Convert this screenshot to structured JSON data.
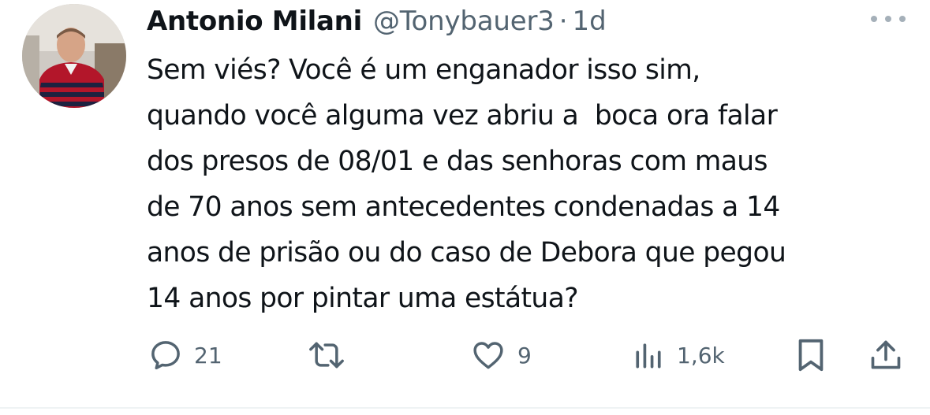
{
  "tweet": {
    "author": {
      "display_name": "Antonio Milani",
      "handle": "@Tonybauer3",
      "separator": "·",
      "time": "1d"
    },
    "text_lines": [
      "Sem viés? Você é um enganador isso sim,",
      "quando você alguma vez abriu a  boca ora falar",
      "dos presos de 08/01 e das senhoras com maus",
      "de 70 anos sem antecedentes condenadas a 14",
      "anos de prisão ou do caso de Debora que pegou",
      "14 anos por pintar uma estátua?"
    ],
    "actions": {
      "replies": "21",
      "retweets": "",
      "likes": "9",
      "views": "1,6k"
    }
  },
  "icons": {
    "more": "more-dots-icon",
    "reply": "reply-bubble-icon",
    "retweet": "retweet-icon",
    "like": "heart-icon",
    "views": "views-bar-chart-icon",
    "bookmark": "bookmark-icon",
    "share": "share-icon"
  },
  "colors": {
    "text_primary": "#0f1419",
    "text_secondary": "#536471",
    "icon": "#536471"
  }
}
